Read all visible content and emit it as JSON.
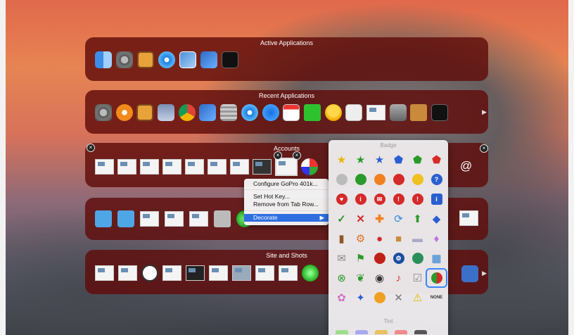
{
  "rows": {
    "active": {
      "title": "Active Applications"
    },
    "recent": {
      "title": "Recent Applications"
    },
    "accounts": {
      "title": "Accounts"
    },
    "site": {
      "title": "Site and Shots"
    }
  },
  "context_menu": {
    "items": [
      {
        "label": "Configure GoPro 401k..."
      },
      {
        "label": "Set Hot Key..."
      },
      {
        "label": "Remove from Tab Row..."
      },
      {
        "label": "Decorate",
        "submenu_arrow": "▶"
      }
    ]
  },
  "badge_panel": {
    "title": "Badge",
    "tint_title": "Tint",
    "none_label": "NONE"
  },
  "row_arrow": "▶",
  "close_glyph": "×",
  "colors": {
    "row_bg": "#5f0c0a",
    "menu_highlight": "#2f6fe0"
  }
}
